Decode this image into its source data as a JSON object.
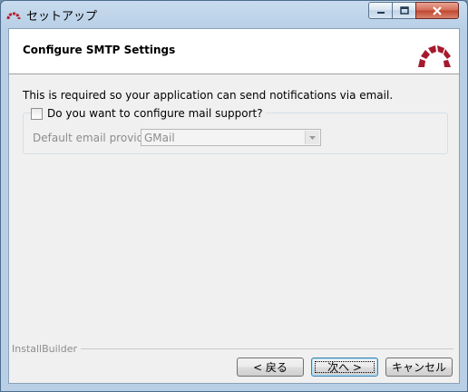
{
  "window": {
    "title": "セットアップ",
    "controls": {
      "minimize": "minimize",
      "maximize": "maximize",
      "close": "close"
    }
  },
  "header": {
    "title": "Configure SMTP Settings",
    "logo_colors": [
      "#a6192e",
      "#a6192e"
    ]
  },
  "body": {
    "description": "This is required so your application can send notifications via email.",
    "mail_support": {
      "label": "Do you want to configure mail support?",
      "checked": false
    },
    "provider": {
      "label": "Default email provider:",
      "value": "GMail",
      "enabled": false
    }
  },
  "footer": {
    "brand": "InstallBuilder",
    "back_label": "< 戻る",
    "next_label": "次へ >",
    "cancel_label": "キャンセル"
  }
}
